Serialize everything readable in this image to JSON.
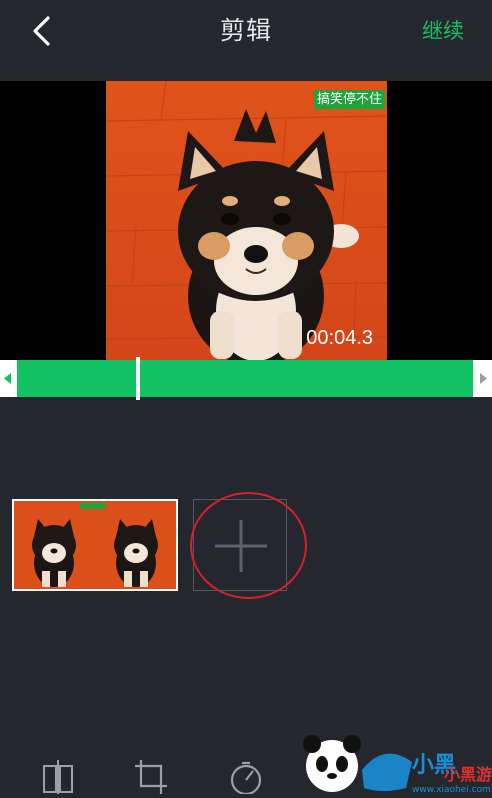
{
  "header": {
    "title": "剪辑",
    "continue_label": "继续"
  },
  "player": {
    "watermark_text": "搞笑停不住",
    "timestamp": "00:04.3"
  },
  "trim": {
    "playhead_fraction": 0.26
  },
  "clips": [
    {
      "label": "clip-1"
    }
  ],
  "toolbar": {
    "icons": [
      "split-icon",
      "crop-icon",
      "speed-icon"
    ]
  },
  "brand": {
    "text_cn": "小黑游戏",
    "url": "www.xiaohei.com"
  },
  "colors": {
    "accent": "#18c061",
    "background": "#25272e",
    "highlight_ring": "#d6202a"
  }
}
